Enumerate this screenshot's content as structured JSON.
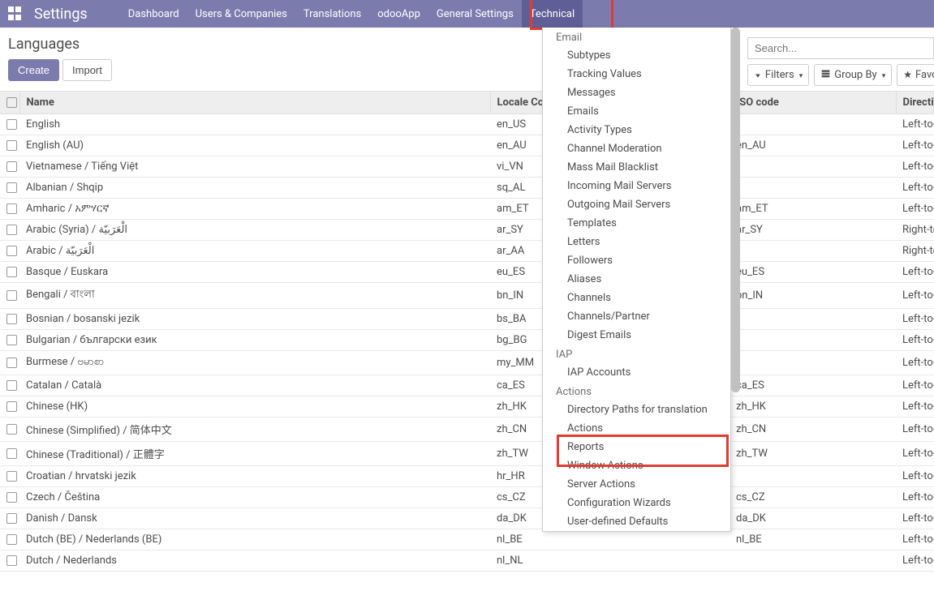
{
  "navbar": {
    "brand": "Settings",
    "items": [
      "Dashboard",
      "Users & Companies",
      "Translations",
      "odooApp",
      "General Settings",
      "Technical"
    ]
  },
  "breadcrumb": "Languages",
  "toolbar": {
    "create": "Create",
    "import": "Import"
  },
  "search": {
    "placeholder": "Search..."
  },
  "filters": {
    "filters": "Filters",
    "groupby": "Group By",
    "favorites": "Favorites"
  },
  "columns": {
    "name": "Name",
    "locale": "Locale Code",
    "iso": "ISO code",
    "direction": "Direction"
  },
  "rows": [
    {
      "name": "English",
      "locale": "en_US",
      "iso": "",
      "direction": "Left-to-Right"
    },
    {
      "name": "English (AU)",
      "locale": "en_AU",
      "iso": "en_AU",
      "direction": "Left-to-Right"
    },
    {
      "name": "Vietnamese / Tiếng Việt",
      "locale": "vi_VN",
      "iso": "",
      "direction": "Left-to-Right"
    },
    {
      "name": "Albanian / Shqip",
      "locale": "sq_AL",
      "iso": "",
      "direction": "Left-to-Right"
    },
    {
      "name": "Amharic / አምሃርኛ",
      "locale": "am_ET",
      "iso": "am_ET",
      "direction": "Left-to-Right"
    },
    {
      "name": "Arabic (Syria) / الْعَرَبيّة",
      "locale": "ar_SY",
      "iso": "ar_SY",
      "direction": "Right-to-Left"
    },
    {
      "name": "Arabic / الْعَرَبيّة",
      "locale": "ar_AA",
      "iso": "",
      "direction": "Right-to-Left"
    },
    {
      "name": "Basque / Euskara",
      "locale": "eu_ES",
      "iso": "eu_ES",
      "direction": "Left-to-Right"
    },
    {
      "name": "Bengali / বাংলা",
      "locale": "bn_IN",
      "iso": "bn_IN",
      "direction": "Left-to-Right"
    },
    {
      "name": "Bosnian / bosanski jezik",
      "locale": "bs_BA",
      "iso": "",
      "direction": "Left-to-Right"
    },
    {
      "name": "Bulgarian / български език",
      "locale": "bg_BG",
      "iso": "",
      "direction": "Left-to-Right"
    },
    {
      "name": "Burmese / ဗမာစာ",
      "locale": "my_MM",
      "iso": "",
      "direction": "Left-to-Right"
    },
    {
      "name": "Catalan / Català",
      "locale": "ca_ES",
      "iso": "ca_ES",
      "direction": "Left-to-Right"
    },
    {
      "name": "Chinese (HK)",
      "locale": "zh_HK",
      "iso": "zh_HK",
      "direction": "Left-to-Right"
    },
    {
      "name": "Chinese (Simplified) / 简体中文",
      "locale": "zh_CN",
      "iso": "zh_CN",
      "direction": "Left-to-Right"
    },
    {
      "name": "Chinese (Traditional) / 正體字",
      "locale": "zh_TW",
      "iso": "zh_TW",
      "direction": "Left-to-Right"
    },
    {
      "name": "Croatian / hrvatski jezik",
      "locale": "hr_HR",
      "iso": "",
      "direction": "Left-to-Right"
    },
    {
      "name": "Czech / Čeština",
      "locale": "cs_CZ",
      "iso": "cs_CZ",
      "direction": "Left-to-Right"
    },
    {
      "name": "Danish / Dansk",
      "locale": "da_DK",
      "iso": "da_DK",
      "direction": "Left-to-Right"
    },
    {
      "name": "Dutch (BE) / Nederlands (BE)",
      "locale": "nl_BE",
      "iso": "nl_BE",
      "direction": "Left-to-Right"
    },
    {
      "name": "Dutch / Nederlands",
      "locale": "nl_NL",
      "iso": "",
      "direction": "Left-to-Right"
    }
  ],
  "dropdown": {
    "sections": [
      {
        "title": "Email",
        "items": [
          "Subtypes",
          "Tracking Values",
          "Messages",
          "Emails",
          "Activity Types",
          "Channel Moderation",
          "Mass Mail Blacklist",
          "Incoming Mail Servers",
          "Outgoing Mail Servers",
          "Templates",
          "Letters",
          "Followers",
          "Aliases",
          "Channels",
          "Channels/Partner",
          "Digest Emails"
        ]
      },
      {
        "title": "IAP",
        "items": [
          "IAP Accounts"
        ]
      },
      {
        "title": "Actions",
        "items": [
          "Directory Paths for translation",
          "Actions",
          "Reports",
          "Window Actions",
          "Server Actions",
          "Configuration Wizards",
          "User-defined Defaults"
        ]
      }
    ]
  }
}
